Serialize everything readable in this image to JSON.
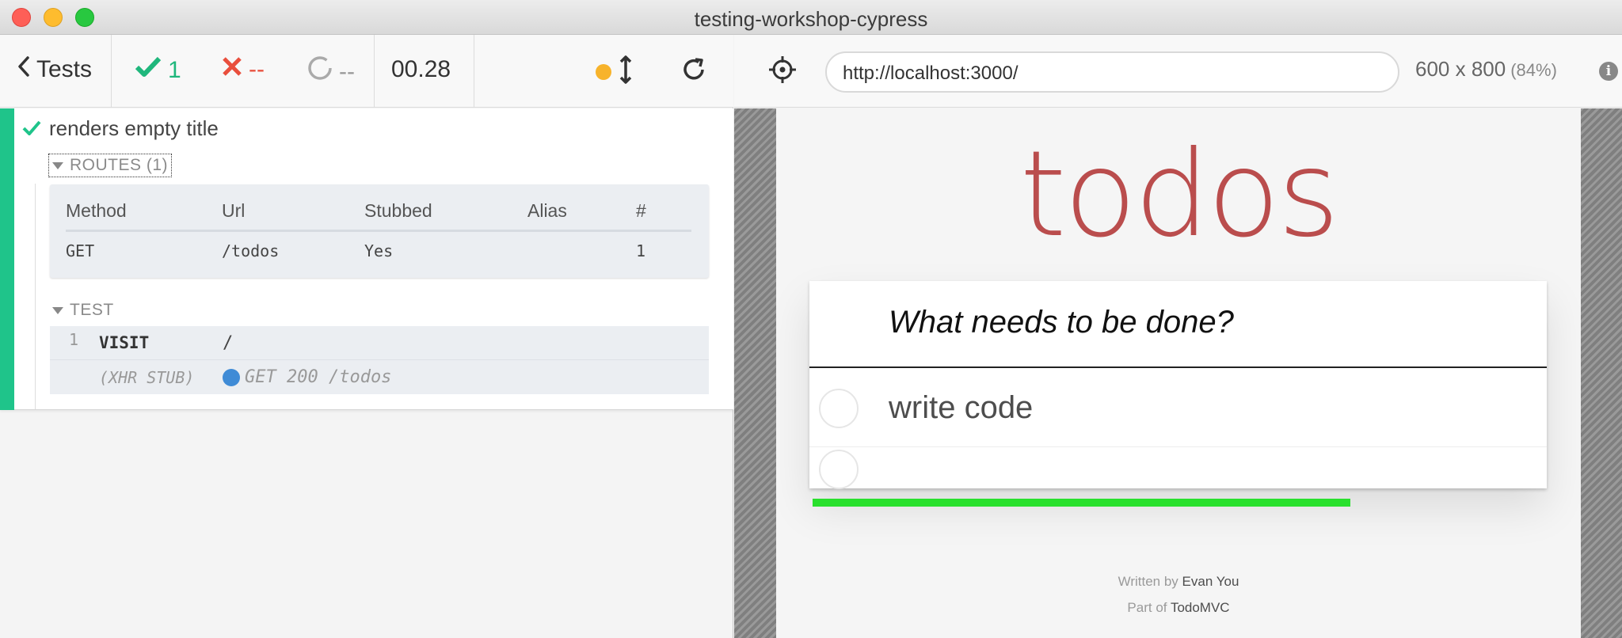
{
  "window": {
    "title": "testing-workshop-cypress"
  },
  "reporter": {
    "tests_label": "Tests",
    "passed": "1",
    "failed": "--",
    "pending": "--",
    "duration": "00.28",
    "test": {
      "title": "renders empty title",
      "routes": {
        "heading": "ROUTES (1)",
        "columns": [
          "Method",
          "Url",
          "Stubbed",
          "Alias",
          "#"
        ],
        "rows": [
          {
            "method": "GET",
            "url": "/todos",
            "stubbed": "Yes",
            "alias": "",
            "count": "1"
          }
        ]
      },
      "commands_heading": "TEST",
      "commands": [
        {
          "number": "1",
          "name": "VISIT",
          "message": "/"
        },
        {
          "name": "(XHR STUB)",
          "message": "GET 200 /todos"
        }
      ]
    }
  },
  "aut": {
    "url": "http://localhost:3000/",
    "viewport": "600 x 800",
    "scale": "(84%)",
    "app": {
      "title": "todos",
      "new_todo_placeholder": "What needs to be done?",
      "items": [
        "write code",
        ""
      ],
      "footer_written_prefix": "Written by",
      "footer_written_name": "Evan You",
      "footer_part_prefix": "Part of",
      "footer_part_name": "TodoMVC"
    }
  },
  "colors": {
    "pass": "#1fc48a",
    "fail": "#e94f3d",
    "accent_yellow": "#f7b32b",
    "todos_red": "#af2f2f",
    "progress_green": "#29e02d"
  }
}
